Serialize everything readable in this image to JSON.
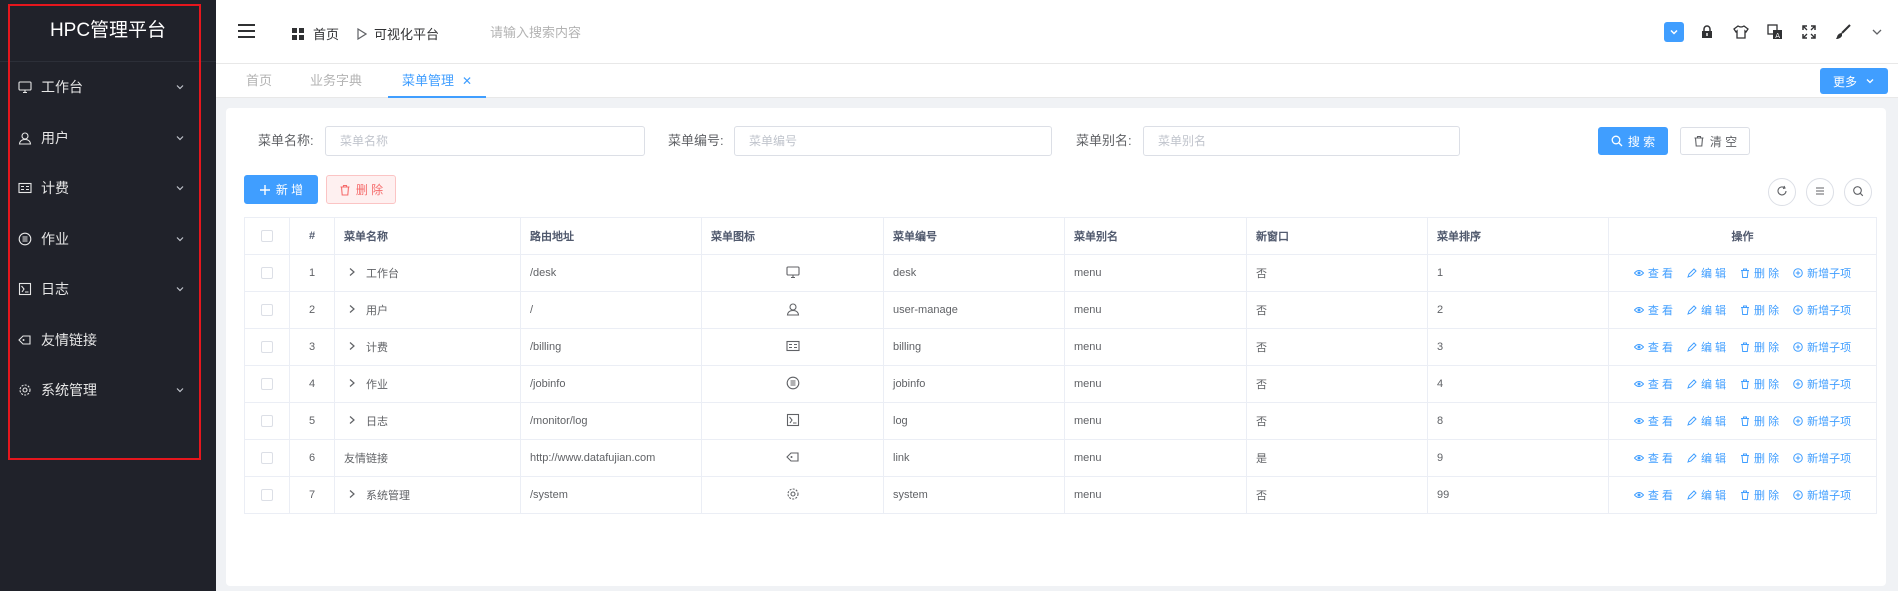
{
  "sidebar": {
    "brand": "HPC管理平台",
    "items": [
      {
        "label": "工作台",
        "icon": "monitor-icon",
        "expandable": true
      },
      {
        "label": "用户",
        "icon": "user-icon",
        "expandable": true
      },
      {
        "label": "计费",
        "icon": "billing-card-icon",
        "expandable": true
      },
      {
        "label": "作业",
        "icon": "list-circle-icon",
        "expandable": true
      },
      {
        "label": "日志",
        "icon": "log-icon",
        "expandable": true
      },
      {
        "label": "友情链接",
        "icon": "tag-link-icon",
        "expandable": false
      },
      {
        "label": "系统管理",
        "icon": "gear-icon",
        "expandable": true
      }
    ]
  },
  "header": {
    "breadcrumb_home": "首页",
    "breadcrumb_current": "可视化平台",
    "search_placeholder": "请输入搜索内容"
  },
  "tags": {
    "items": [
      "首页",
      "业务字典",
      "菜单管理"
    ],
    "active_index": 2,
    "more_label": "更多"
  },
  "search": {
    "name_label": "菜单名称:",
    "name_placeholder": "菜单名称",
    "code_label": "菜单编号:",
    "code_placeholder": "菜单编号",
    "alias_label": "菜单别名:",
    "alias_placeholder": "菜单别名",
    "search_button": "搜 索",
    "clear_button": "清 空"
  },
  "toolbar": {
    "add_button": "新 增",
    "delete_button": "删 除"
  },
  "table": {
    "columns": [
      "#",
      "菜单名称",
      "路由地址",
      "菜单图标",
      "菜单编号",
      "菜单别名",
      "新窗口",
      "菜单排序",
      "操作"
    ],
    "rows": [
      {
        "index": "1",
        "name": "工作台",
        "path": "/desk",
        "icon": "monitor-icon",
        "code": "desk",
        "alias": "menu",
        "new_window": "否",
        "sort": "1",
        "expandable": true
      },
      {
        "index": "2",
        "name": "用户",
        "path": "/",
        "icon": "user-icon",
        "code": "user-manage",
        "alias": "menu",
        "new_window": "否",
        "sort": "2",
        "expandable": true
      },
      {
        "index": "3",
        "name": "计费",
        "path": "/billing",
        "icon": "billing-card-icon",
        "code": "billing",
        "alias": "menu",
        "new_window": "否",
        "sort": "3",
        "expandable": true
      },
      {
        "index": "4",
        "name": "作业",
        "path": "/jobinfo",
        "icon": "list-circle-icon",
        "code": "jobinfo",
        "alias": "menu",
        "new_window": "否",
        "sort": "4",
        "expandable": true
      },
      {
        "index": "5",
        "name": "日志",
        "path": "/monitor/log",
        "icon": "log-icon",
        "code": "log",
        "alias": "menu",
        "new_window": "否",
        "sort": "8",
        "expandable": true
      },
      {
        "index": "6",
        "name": "友情链接",
        "path": "http://www.datafujian.com",
        "icon": "tag-link-icon",
        "code": "link",
        "alias": "menu",
        "new_window": "是",
        "sort": "9",
        "expandable": false
      },
      {
        "index": "7",
        "name": "系统管理",
        "path": "/system",
        "icon": "gear-icon",
        "code": "system",
        "alias": "menu",
        "new_window": "否",
        "sort": "99",
        "expandable": true
      }
    ],
    "actions": {
      "view": "查 看",
      "edit": "编 辑",
      "delete": "删 除",
      "add_child": "新增子项"
    }
  },
  "colors": {
    "sidebar_bg": "#20222a",
    "accent": "#409eff",
    "danger": "#f56c6c",
    "highlight_frame": "#e5161d"
  }
}
